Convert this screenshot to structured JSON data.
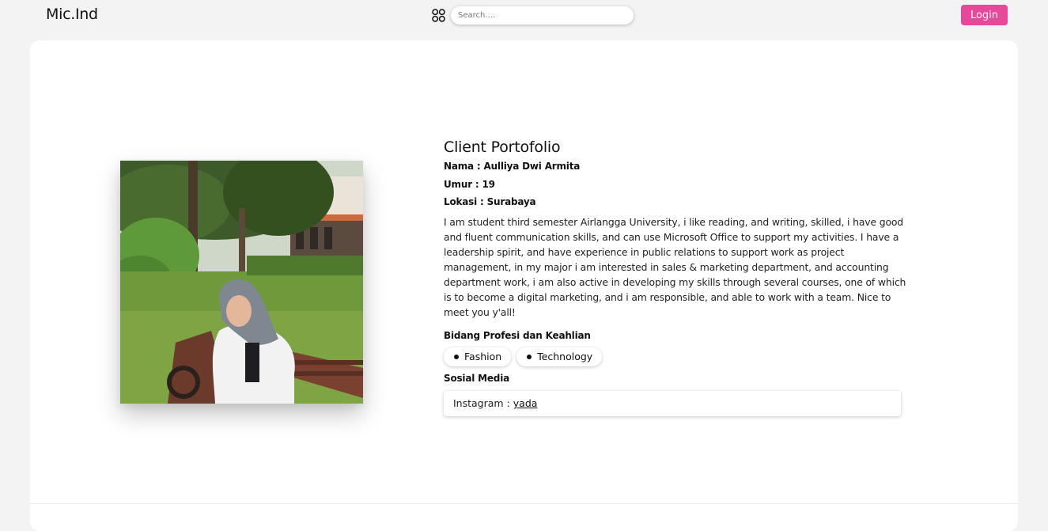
{
  "header": {
    "brand": "Mic.Ind",
    "search_placeholder": "Search....",
    "login_label": "Login",
    "grid_icon": "apps-grid-icon",
    "login_color": "#e8489a"
  },
  "profile": {
    "title": "Client Portofolio",
    "nama": "Nama : Aulliya Dwi Armita",
    "umur": "Umur : 19",
    "lokasi": "Lokasi : Surabaya",
    "bio": "I am student third semester Airlangga University, i like reading, and writing, skilled, i have good and fluent communication skills, and can use Microsoft Office to support my activities. I have a leadership spirit, and have experience in public relations to support work as project management, in my major i am interested in sales & marketing department, and accounting department work, i am also active in developing my skills through several courses, one of which is to become a digital marketing, and i am responsible, and able to work with a team. Nice to meet you y'all!",
    "skills_label": "Bidang Profesi dan Keahlian",
    "skills": [
      "Fashion",
      "Technology"
    ],
    "social_label": "Sosial Media",
    "social": {
      "platform": "Instagram :",
      "handle": "yada"
    }
  }
}
